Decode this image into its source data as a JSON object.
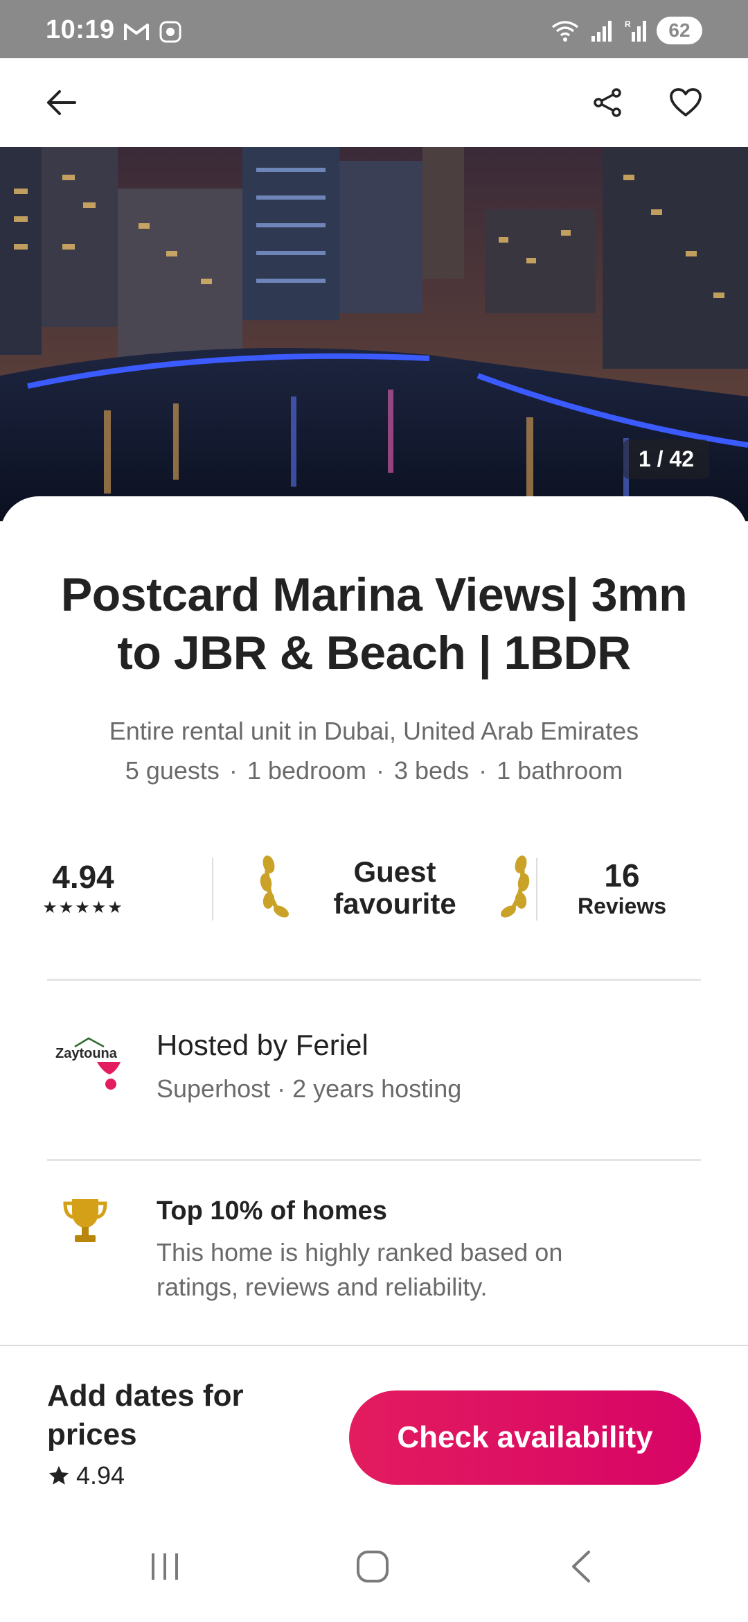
{
  "status_bar": {
    "time": "10:19",
    "battery": "62",
    "left_icons": [
      "gmail-icon",
      "app-notification-icon"
    ],
    "right_icons": [
      "wifi-icon",
      "signal-icon",
      "signal-roaming-icon"
    ]
  },
  "header": {
    "back_icon": "arrow-left-icon",
    "share_icon": "share-icon",
    "favorite_icon": "heart-icon"
  },
  "hero": {
    "photo_counter": "1 / 42"
  },
  "listing": {
    "title": "Postcard Marina Views| 3mn to JBR & Beach | 1BDR",
    "subtitle": "Entire rental unit in Dubai, United Arab Emirates",
    "details": [
      "5 guests",
      "1 bedroom",
      "3 beds",
      "1 bathroom"
    ],
    "separator": "·"
  },
  "rating": {
    "value": "4.94",
    "stars": "★★★★★",
    "guest_favourite_line1": "Guest",
    "guest_favourite_line2": "favourite",
    "reviews_count": "16",
    "reviews_label": "Reviews"
  },
  "host": {
    "avatar_text": "Zaytouna",
    "name": "Hosted by Feriel",
    "meta": "Superhost · 2 years hosting"
  },
  "highlight": {
    "icon": "trophy-icon",
    "title": "Top 10% of homes",
    "description": "This home is highly ranked based on ratings, reviews and reliability."
  },
  "booking_bar": {
    "price_prompt": "Add dates for prices",
    "rating": "4.94",
    "cta_label": "Check availability",
    "cta_color": "#e31c5f"
  },
  "system_nav": {
    "recents_icon": "recents-icon",
    "home_icon": "home-icon",
    "back_icon": "back-chevron-icon"
  }
}
